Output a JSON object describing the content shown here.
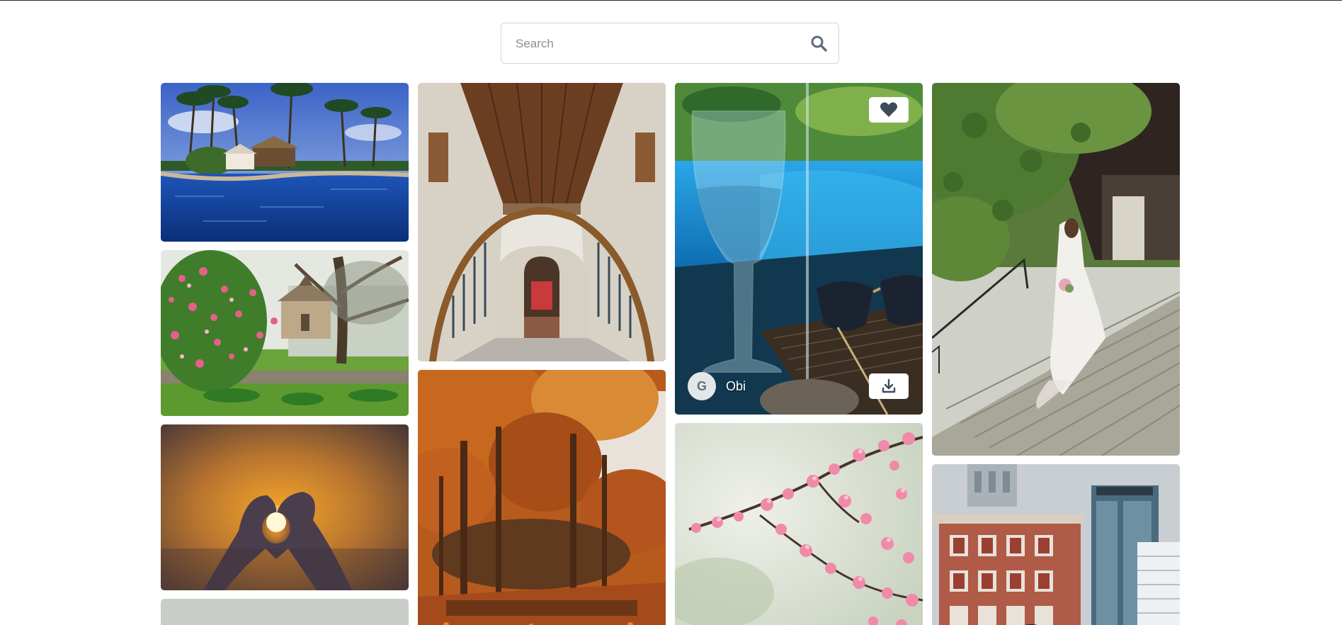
{
  "search": {
    "placeholder": "Search",
    "value": ""
  },
  "icons": {
    "search": "search-icon",
    "like": "heart-icon",
    "download": "download-icon",
    "avatar": "google-g-icon"
  },
  "colors": {
    "icon": "#3d4a5c",
    "border": "#d4d7dd"
  },
  "gallery": {
    "hovered_photo": {
      "author_name": "Obi",
      "author_avatar_letter": "G"
    }
  }
}
